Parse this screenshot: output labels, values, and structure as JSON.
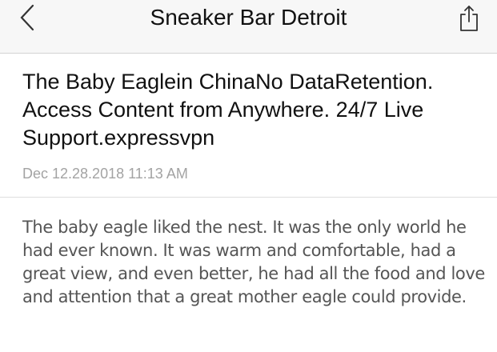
{
  "navbar": {
    "title": "Sneaker Bar Detroit",
    "back_icon": "chevron-left-icon",
    "share_icon": "share-icon"
  },
  "article": {
    "title": "The Baby Eaglein ChinaNo DataRetention. Access Content from Anywhere. 24/7 Live Support.expressvpn",
    "date": "Dec 12.28.2018 11:13 AM",
    "body": "The baby eagle liked the nest. It was the only world he had ever known. It was warm and comfortable, had a great view, and even better, he had all the food and love and attention that a great mother eagle could provide."
  },
  "colors": {
    "navbar_bg": "#f7f7f7",
    "date_text": "#a3a3a3",
    "body_text": "#555555"
  }
}
